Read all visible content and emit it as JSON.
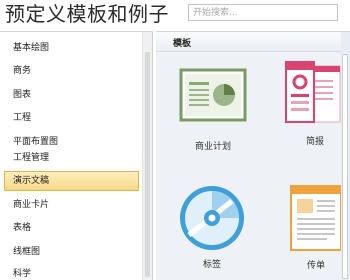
{
  "header": {
    "title": "预定义模板和例子",
    "search_placeholder": "开始搜索..."
  },
  "sidebar": {
    "categories": [
      {
        "label": "基本绘图"
      },
      {
        "label": "商务"
      },
      {
        "label": "图表"
      },
      {
        "label": "工程"
      },
      {
        "label": "平面布置图"
      },
      {
        "label": "工程管理"
      },
      {
        "label": "演示文稿",
        "selected": true
      },
      {
        "label": "商业卡片"
      },
      {
        "label": "表格"
      },
      {
        "label": "线框图"
      },
      {
        "label": "科学"
      }
    ]
  },
  "main": {
    "section_label": "模板",
    "templates": [
      {
        "label": "商业计划",
        "icon": "business-plan-icon"
      },
      {
        "label": "简报",
        "icon": "brochure-icon"
      },
      {
        "label": "标签",
        "icon": "cd-label-icon"
      },
      {
        "label": "传单",
        "icon": "flyer-icon"
      }
    ]
  },
  "colors": {
    "selection_fill": "#f8d887",
    "selection_border": "#e3b649",
    "panel_bg": "#eef1f6",
    "business_plan_green": "#7a9a62",
    "brochure_pink": "#d8436f",
    "cd_blue": "#3f9fd8",
    "flyer_orange": "#f0a23a"
  }
}
